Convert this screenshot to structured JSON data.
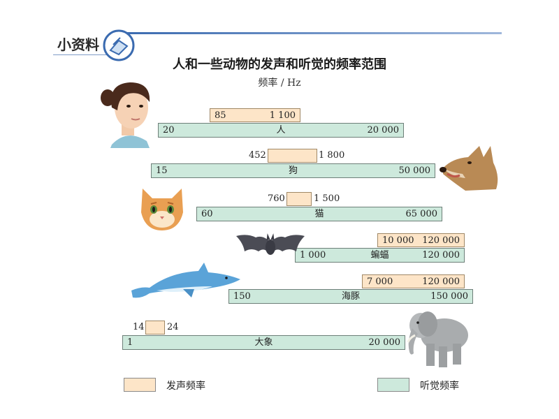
{
  "header": {
    "label": "小资料"
  },
  "title": "人和一些动物的发声和听觉的频率范围",
  "unit": "频率 / Hz",
  "colors": {
    "voice": "#fde5c8",
    "hearing": "#cde9dc",
    "accent": "#3b6bb0"
  },
  "rows": [
    {
      "name": "人",
      "hear_min": "20",
      "hear_max": "20 000",
      "voice_min": "85",
      "voice_max": "1 100"
    },
    {
      "name": "狗",
      "hear_min": "15",
      "hear_max": "50 000",
      "voice_min": "452",
      "voice_max": "1 800"
    },
    {
      "name": "猫",
      "hear_min": "60",
      "hear_max": "65 000",
      "voice_min": "760",
      "voice_max": "1 500"
    },
    {
      "name": "蝙蝠",
      "hear_min": "1 000",
      "hear_max": "120 000",
      "voice_min": "10 000",
      "voice_max": "120 000"
    },
    {
      "name": "海豚",
      "hear_min": "150",
      "hear_max": "150 000",
      "voice_min": "7 000",
      "voice_max": "120 000"
    },
    {
      "name": "大象",
      "hear_min": "1",
      "hear_max": "20 000",
      "voice_min": "14",
      "voice_max": "24"
    }
  ],
  "legend": {
    "voice": "发声频率",
    "hearing": "听觉频率"
  },
  "icons": [
    "book-icon",
    "human-face-icon",
    "dog-icon",
    "cat-icon",
    "bat-icon",
    "dolphin-icon",
    "elephant-icon"
  ]
}
